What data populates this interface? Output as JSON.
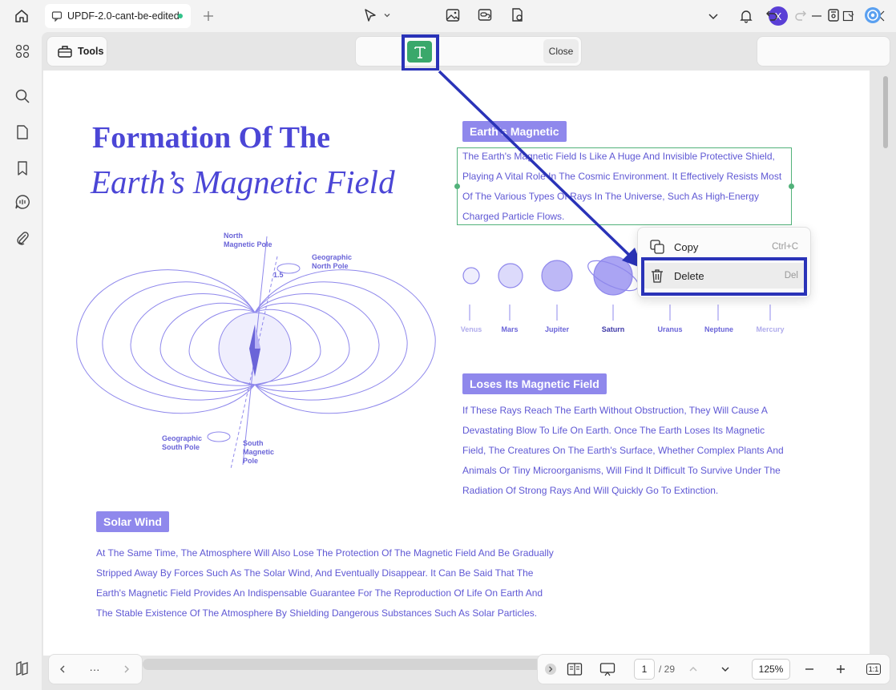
{
  "titlebar": {
    "tab_title": "UPDF-2.0-cant-be-edited",
    "avatar_letter": "X"
  },
  "toolbar": {
    "tools_label": "Tools",
    "close_label": "Close"
  },
  "document": {
    "title_line1": "Formation Of The",
    "title_line2": "Earth’s Magnetic Field",
    "section1": {
      "heading": "Earth’s Magnetic",
      "lines": [
        "The Earth's Magnetic Field Is Like A Huge And Invisible Protective Shield,",
        "Playing A Vital Role In The Cosmic Environment. It Effectively Resists Most",
        "Of The Various Types Of Rays In The Universe, Such As High-Energy",
        "Charged Particle Flows."
      ]
    },
    "planets": [
      "Venus",
      "Mars",
      "Jupiter",
      "Saturn",
      "Uranus",
      "Neptune",
      "Mercury"
    ],
    "section2": {
      "heading": "Loses Its Magnetic Field",
      "lines": [
        "If These Rays Reach The Earth Without Obstruction, They Will Cause A",
        "Devastating Blow To Life On Earth. Once The Earth Loses Its Magnetic",
        "Field, The Creatures On The Earth's Surface, Whether Complex Plants And",
        "Animals Or Tiny Microorganisms, Will Find It Difficult To Survive Under The",
        "Radiation Of Strong Rays And Will Quickly Go To Extinction."
      ]
    },
    "section3": {
      "heading": "Solar Wind",
      "lines": [
        "At The Same Time, The Atmosphere Will Also Lose The Protection Of The Magnetic Field And Be Gradually",
        "Stripped Away By Forces Such As The Solar Wind, And Eventually Disappear. It Can Be Said That The",
        "Earth's Magnetic Field Provides An Indispensable Guarantee For The Reproduction Of Life On Earth And",
        "The Stable Existence Of The Atmosphere By Shielding Dangerous Substances Such As Solar Particles."
      ]
    },
    "diagram_labels": {
      "north_magnetic_l1": "North",
      "north_magnetic_l2": "Magnetic Pole",
      "geo_north_l1": "Geographic",
      "geo_north_l2": "North Pole",
      "angle": "1.5",
      "geo_south_l1": "Geographic",
      "geo_south_l2": "South Pole",
      "south_magnetic_l1": "South",
      "south_magnetic_l2": "Magnetic",
      "south_magnetic_l3": "Pole"
    }
  },
  "context_menu": {
    "copy_label": "Copy",
    "copy_shortcut": "Ctrl+C",
    "delete_label": "Delete",
    "delete_shortcut": "Del"
  },
  "bottom_nav": {
    "more": "···",
    "current_page": "1",
    "total_pages": "/ 29",
    "zoom": "125%",
    "fit_label": "1:1"
  },
  "colors": {
    "accent": "#4b46d6",
    "chip": "#8f88ec",
    "text_tool": "#3aa86b",
    "highlight": "#2a33b8"
  }
}
